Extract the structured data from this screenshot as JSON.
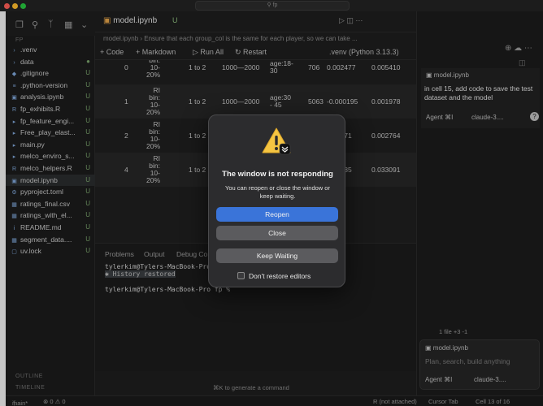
{
  "window": {
    "search_text": "fp"
  },
  "explorer": {
    "root_label": "FP",
    "files": [
      {
        "name": ".venv",
        "status": "",
        "icon": "folder-icon"
      },
      {
        "name": "data",
        "status": "●",
        "icon": "folder-icon"
      },
      {
        "name": ".gitignore",
        "status": "U",
        "icon": "git-icon"
      },
      {
        "name": ".python-version",
        "status": "U",
        "icon": "text-icon"
      },
      {
        "name": "analysis.ipynb",
        "status": "U",
        "icon": "notebook-icon"
      },
      {
        "name": "fp_exhibits.R",
        "status": "U",
        "icon": "r-icon"
      },
      {
        "name": "fp_feature_engi...",
        "status": "U",
        "icon": "python-icon"
      },
      {
        "name": "Free_play_elast...",
        "status": "U",
        "icon": "python-icon"
      },
      {
        "name": "main.py",
        "status": "U",
        "icon": "python-icon"
      },
      {
        "name": "melco_enviro_s...",
        "status": "U",
        "icon": "python-icon"
      },
      {
        "name": "melco_helpers.R",
        "status": "U",
        "icon": "r-icon"
      },
      {
        "name": "model.ipynb",
        "status": "U",
        "icon": "notebook-icon"
      },
      {
        "name": "pyproject.toml",
        "status": "U",
        "icon": "gear-icon"
      },
      {
        "name": "ratings_final.csv",
        "status": "U",
        "icon": "table-icon"
      },
      {
        "name": "ratings_with_el...",
        "status": "U",
        "icon": "table-icon"
      },
      {
        "name": "README.md",
        "status": "U",
        "icon": "info-icon"
      },
      {
        "name": "segment_data....",
        "status": "U",
        "icon": "table-icon"
      },
      {
        "name": "uv.lock",
        "status": "U",
        "icon": "lock-icon"
      }
    ],
    "outline_label": "OUTLINE",
    "timeline_label": "TIMELINE"
  },
  "editor": {
    "tab_label": "model.ipynb",
    "tab_status": "U",
    "breadcrumb": "model.ipynb  ›  Ensure that each group_col is the same for each player, so we can take ...",
    "toolbar": {
      "code": "+ Code",
      "markdown": "+ Markdown",
      "run_all": "▷ Run All",
      "restart": "↻ Restart",
      "kernel": ".venv (Python 3.13.3)"
    },
    "rows": [
      {
        "idx": "0",
        "bin": "bin:\n10-\n20%",
        "rounds": "1 to 2",
        "range": "1000—2000",
        "age": "age:18-\n30",
        "n": "706",
        "v1": "0.002477",
        "v2": "0.005410"
      },
      {
        "idx": "1",
        "bin": "RI\nbin:\n10-\n20%",
        "rounds": "1 to 2",
        "range": "1000—2000",
        "age": "age:30\n- 45",
        "n": "5063",
        "v1": "-0.000195",
        "v2": "0.001978"
      },
      {
        "idx": "2",
        "bin": "RI\nbin:\n10-\n20%",
        "rounds": "1 to 2",
        "range": "",
        "age": "",
        "n": "",
        "v1": "0.06471",
        "v2": "0.002764"
      },
      {
        "idx": "4",
        "bin": "RI\nbin:\n10-\n20%",
        "rounds": "1 to 2",
        "range": "",
        "age": "",
        "n": "",
        "v1": "0.08485",
        "v2": "0.033091"
      }
    ]
  },
  "panel": {
    "tabs": [
      "Problems",
      "Output",
      "Debug Co"
    ],
    "line1": "tylerkim@Tylers-MacBook-Pro fp %",
    "restored": "✱  History restored",
    "line2": "tylerkim@Tylers-MacBook-Pro fp %",
    "cmd_hint": "⌘K to generate a command"
  },
  "chat": {
    "file_chip": "model.ipynb",
    "message": "in cell 15, add code to save the test dataset and the model",
    "agent_label": "Agent ⌘I",
    "model_label": "claude-3....",
    "files_changed": "1 file +3 -1",
    "input_file_chip": "model.ipynb",
    "input_placeholder": "Plan, search, build anything",
    "input_agent_label": "Agent ⌘I",
    "input_model_label": "claude-3...."
  },
  "statusbar": {
    "branch": "main*",
    "counts": "⊗ 0 ⚠ 0",
    "kernel_state": "R (not attached)",
    "cursor_tab": "Cursor Tab",
    "cell": "Cell 13 of 16"
  },
  "dialog": {
    "title": "The window is not responding",
    "message": "You can reopen or close the window or keep waiting.",
    "reopen": "Reopen",
    "close": "Close",
    "keep_waiting": "Keep Waiting",
    "dont_restore": "Don't restore editors",
    "warning_color": "#f5c542"
  }
}
